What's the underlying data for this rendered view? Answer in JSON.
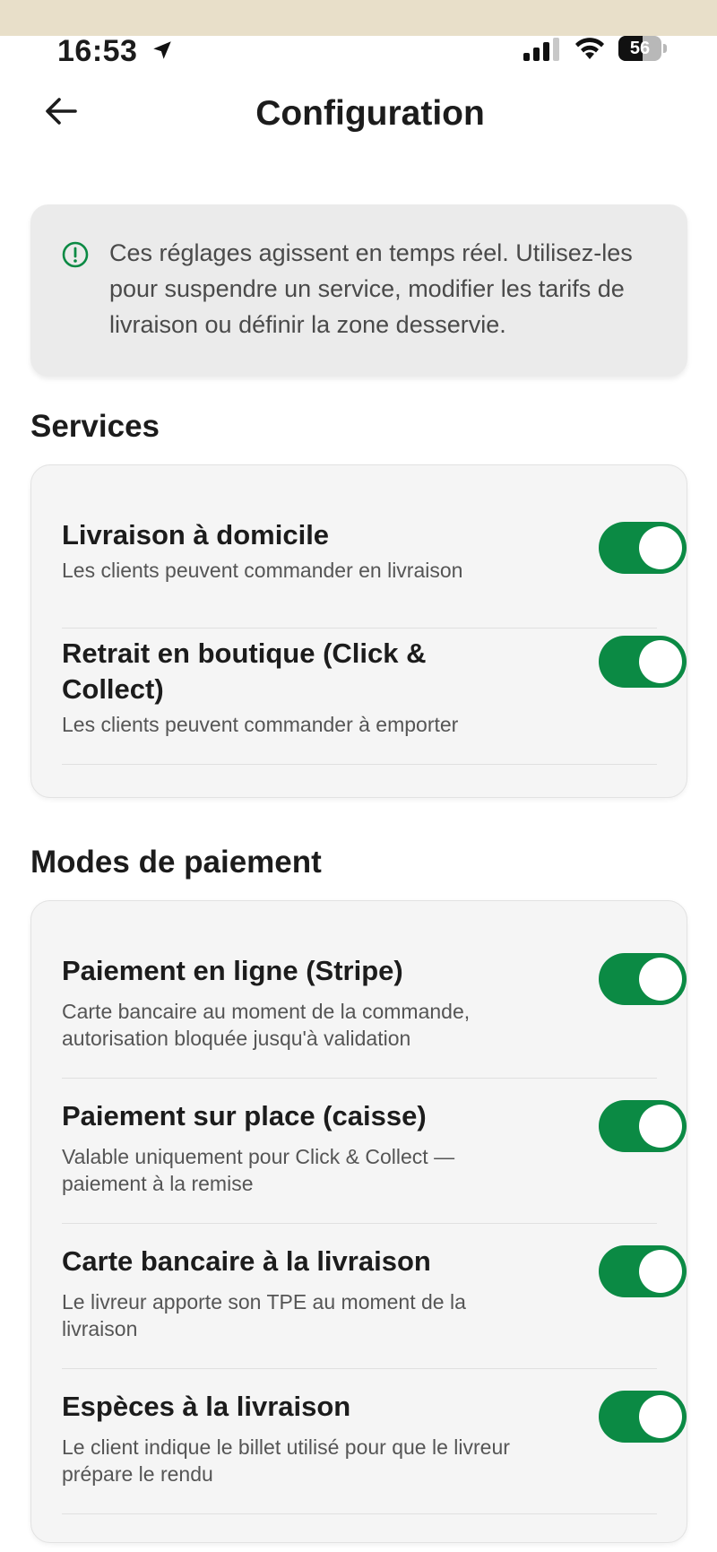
{
  "status_bar": {
    "time": "16:53",
    "battery": "56",
    "battery_level": 0.56
  },
  "header": {
    "title": "Configuration"
  },
  "info": {
    "text": "Ces réglages agissent en temps réel. Utilisez-les pour suspendre un service, modifier les tarifs de livraison ou définir la zone desservie."
  },
  "services": {
    "title": "Services",
    "items": [
      {
        "name": "Livraison à domicile",
        "desc": "Les clients peuvent commander en livraison",
        "on": true
      },
      {
        "name": "Retrait en boutique (Click & Collect)",
        "desc": "Les clients peuvent commander à emporter",
        "on": true
      }
    ]
  },
  "payment": {
    "title": "Modes de paiement",
    "items": [
      {
        "name": "Paiement en ligne (Stripe)",
        "desc": "Carte bancaire au moment de la commande, autorisation bloquée jusqu'à validation",
        "on": true
      },
      {
        "name": "Paiement sur place (caisse)",
        "desc": "Valable uniquement pour Click & Collect — paiement à la remise",
        "on": true
      },
      {
        "name": "Carte bancaire à la livraison",
        "desc": "Le livreur apporte son TPE au moment de la livraison",
        "on": true
      },
      {
        "name": "Espèces à la livraison",
        "desc": "Le client indique le billet utilisé pour que le livreur prépare le rendu",
        "on": true
      }
    ]
  },
  "colors": {
    "accent": "#0b8a44",
    "top_strip": "#e8dfc9",
    "card_bg": "#f5f5f5",
    "info_bg": "#ebebeb"
  }
}
